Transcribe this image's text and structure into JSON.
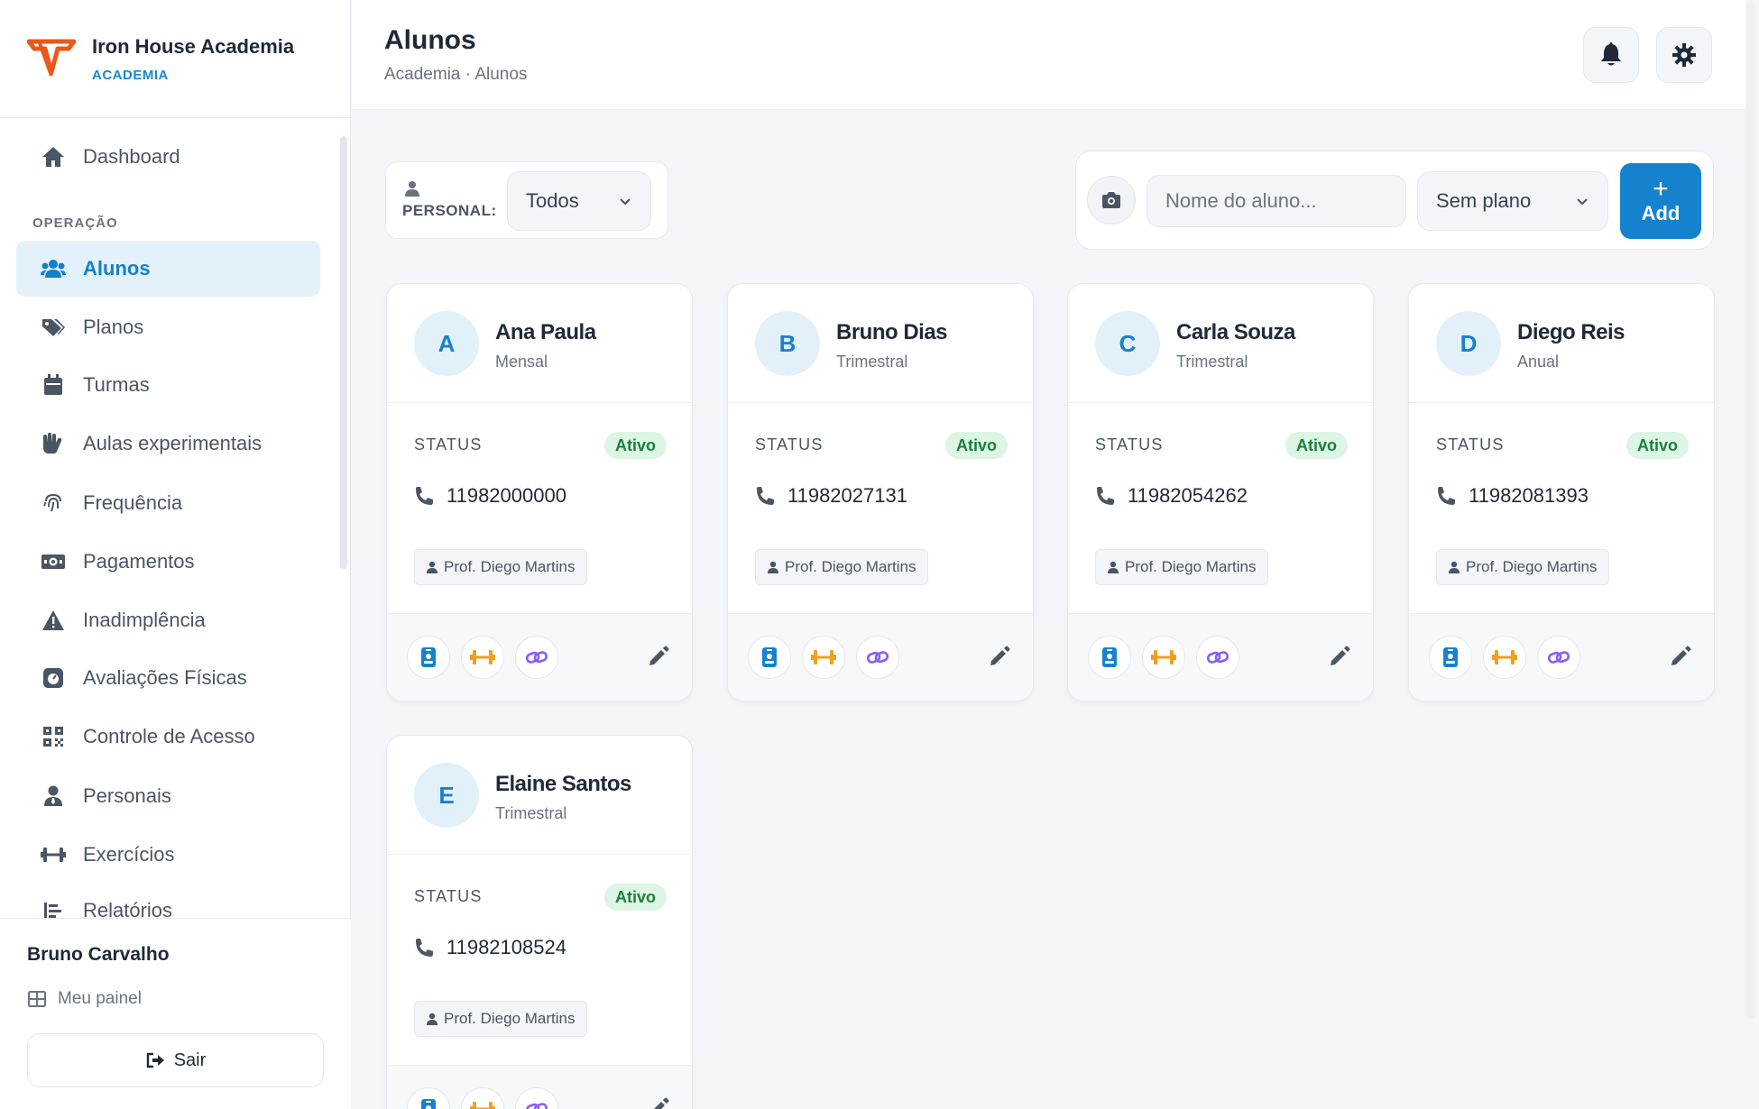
{
  "brand": {
    "name": "Iron House Academia",
    "subtitle": "ACADEMIA"
  },
  "sidebar": {
    "items": [
      {
        "label": "Dashboard",
        "icon": "home-icon"
      },
      {
        "label": "Alunos",
        "icon": "users-icon",
        "active": true
      },
      {
        "label": "Planos",
        "icon": "tags-icon"
      },
      {
        "label": "Turmas",
        "icon": "calendar-icon"
      },
      {
        "label": "Aulas experimentais",
        "icon": "hands-icon"
      },
      {
        "label": "Frequência",
        "icon": "fingerprint-icon"
      },
      {
        "label": "Pagamentos",
        "icon": "money-icon"
      },
      {
        "label": "Inadimplência",
        "icon": "warning-icon"
      },
      {
        "label": "Avaliações Físicas",
        "icon": "gauge-icon"
      },
      {
        "label": "Controle de Acesso",
        "icon": "qrcode-icon"
      },
      {
        "label": "Personais",
        "icon": "user-tie-icon"
      },
      {
        "label": "Exercícios",
        "icon": "dumbbell-icon"
      },
      {
        "label": "Relatórios",
        "icon": "chart-icon"
      }
    ],
    "section_label": "OPERAÇÃO",
    "user_name": "Bruno Carvalho",
    "my_panel_label": "Meu painel",
    "logout_label": "Sair"
  },
  "header": {
    "title": "Alunos",
    "breadcrumb": "Academia · Alunos"
  },
  "filters": {
    "personal_label": "PERSONAL:",
    "personal_value": "Todos",
    "search_placeholder": "Nome do aluno...",
    "plan_value": "Sem plano",
    "add_plus": "+",
    "add_label": "Add"
  },
  "students": [
    {
      "initial": "A",
      "name": "Ana Paula",
      "plan": "Mensal",
      "status_label": "STATUS",
      "status": "Ativo",
      "phone": "11982000000",
      "trainer": "Prof. Diego Martins"
    },
    {
      "initial": "B",
      "name": "Bruno Dias",
      "plan": "Trimestral",
      "status_label": "STATUS",
      "status": "Ativo",
      "phone": "11982027131",
      "trainer": "Prof. Diego Martins"
    },
    {
      "initial": "C",
      "name": "Carla Souza",
      "plan": "Trimestral",
      "status_label": "STATUS",
      "status": "Ativo",
      "phone": "11982054262",
      "trainer": "Prof. Diego Martins"
    },
    {
      "initial": "D",
      "name": "Diego Reis",
      "plan": "Anual",
      "status_label": "STATUS",
      "status": "Ativo",
      "phone": "11982081393",
      "trainer": "Prof. Diego Martins"
    },
    {
      "initial": "E",
      "name": "Elaine Santos",
      "plan": "Trimestral",
      "status_label": "STATUS",
      "status": "Ativo",
      "phone": "11982108524",
      "trainer": "Prof. Diego Martins"
    }
  ],
  "colors": {
    "accent": "#1582cf",
    "status_green": "#1a7f3c",
    "logo_orange": "#e8591a",
    "workout_orange": "#f0a020",
    "link_purple": "#8b5cf6"
  }
}
